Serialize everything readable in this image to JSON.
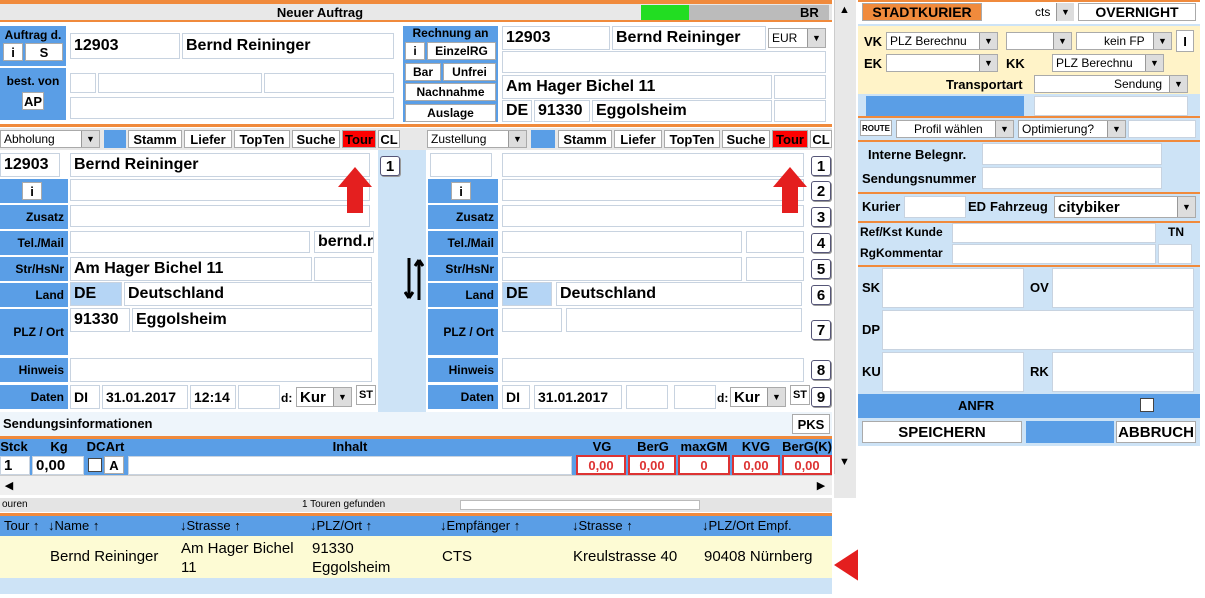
{
  "window": {
    "title": "Neuer Auftrag",
    "br": "BR"
  },
  "auftrag": {
    "label": "Auftrag d.",
    "i": "i",
    "s": "S",
    "number": "12903",
    "name": "Bernd Reininger",
    "best_von": "best. von",
    "ap": "AP"
  },
  "rechnung": {
    "title": "Rechnung an",
    "i": "i",
    "einzel": "EinzelRG",
    "bar": "Bar",
    "unfrei": "Unfrei",
    "nachnahme": "Nachnahme",
    "auslage": "Auslage",
    "number": "12903",
    "name": "Bernd Reininger",
    "currency": "EUR",
    "street": "Am Hager Bichel 11",
    "country": "DE",
    "plz": "91330",
    "city": "Eggolsheim"
  },
  "abholung": {
    "type": "Abholung",
    "stamm": "Stamm",
    "liefer": "Liefer",
    "topten": "TopTen",
    "suche": "Suche",
    "tour": "Tour",
    "cl": "CL",
    "number": "12903",
    "name": "Bernd Reininger",
    "email": "bernd.r",
    "street": "Am Hager Bichel 11",
    "country_code": "DE",
    "country": "Deutschland",
    "plz": "91330",
    "city": "Eggolsheim",
    "day": "DI",
    "date": "31.01.2017",
    "time": "12:14",
    "d_label": "d:",
    "kur": "Kur",
    "st": "ST"
  },
  "zustellung": {
    "type": "Zustellung",
    "stamm": "Stamm",
    "liefer": "Liefer",
    "topten": "TopTen",
    "suche": "Suche",
    "tour": "Tour",
    "cl": "CL",
    "country_code": "DE",
    "country": "Deutschland",
    "day": "DI",
    "date": "31.01.2017",
    "d_label": "d:",
    "kur": "Kur",
    "st": "ST"
  },
  "labels": {
    "i": "i",
    "zusatz": "Zusatz",
    "tel": "Tel./Mail",
    "str": "Str/HsNr",
    "land": "Land",
    "plz": "PLZ / Ort",
    "hinweis": "Hinweis",
    "daten": "Daten"
  },
  "numbers": [
    "1",
    "2",
    "3",
    "4",
    "5",
    "6",
    "7",
    "8",
    "9"
  ],
  "sendung": {
    "title": "Sendungsinformationen",
    "pks": "PKS",
    "cols": [
      "Stck",
      "Kg",
      "DC",
      "Art",
      "Inhalt",
      "VG",
      "BerG",
      "maxGM",
      "KVG",
      "BerG(K)"
    ],
    "stck": "1",
    "kg": "0,00",
    "art": "A",
    "vg": "0,00",
    "berg": "0,00",
    "maxgm": "0",
    "kvg": "0,00",
    "bergk": "0,00"
  },
  "touren": {
    "left": "ouren",
    "found": "1 Touren gefunden",
    "cols": [
      "Tour",
      "Name",
      "Strasse",
      "PLZ/Ort",
      "Empfänger",
      "Strasse",
      "PLZ/Ort Empf."
    ],
    "row": {
      "tour": "",
      "name": "Bernd Reininger",
      "strasse": "Am Hager Bichel 11",
      "plzort": "91330 Eggolsheim",
      "empf": "CTS",
      "strasse2": "Kreulstrasse 40",
      "plzort2": "90408 Nürnberg"
    }
  },
  "right": {
    "stadtkurier": "STADTKURIER",
    "cts": "cts",
    "overnight": "OVERNIGHT",
    "vk": "VK",
    "ek": "EK",
    "kk": "KK",
    "plz_berechnung": "PLZ Berechnu",
    "kein_fp": "kein FP",
    "plz_berechnung2": "PLZ Berechnu",
    "transportart": "Transportart",
    "sendung": "Sendung",
    "route": "ROUTE",
    "profil": "Profil wählen",
    "optimierung": "Optimierung?",
    "interne": "Interne Belegnr.",
    "sendungsnummer": "Sendungsnummer",
    "kurier": "Kurier",
    "ed": "ED",
    "fahrzeug": "Fahrzeug",
    "citybiker": "citybiker",
    "ref": "Ref/Kst Kunde",
    "tn": "TN",
    "rgk": "RgKommentar",
    "sk": "SK",
    "ov": "OV",
    "dp": "DP",
    "ku": "KU",
    "rk": "RK",
    "anfr": "ANFR",
    "speichern": "SPEICHERN",
    "abbruch": "ABBRUCH"
  },
  "colors": {
    "orange": "#f08a3c",
    "blue": "#5a9ee6",
    "red": "#ff0000",
    "green": "#22dd22"
  }
}
